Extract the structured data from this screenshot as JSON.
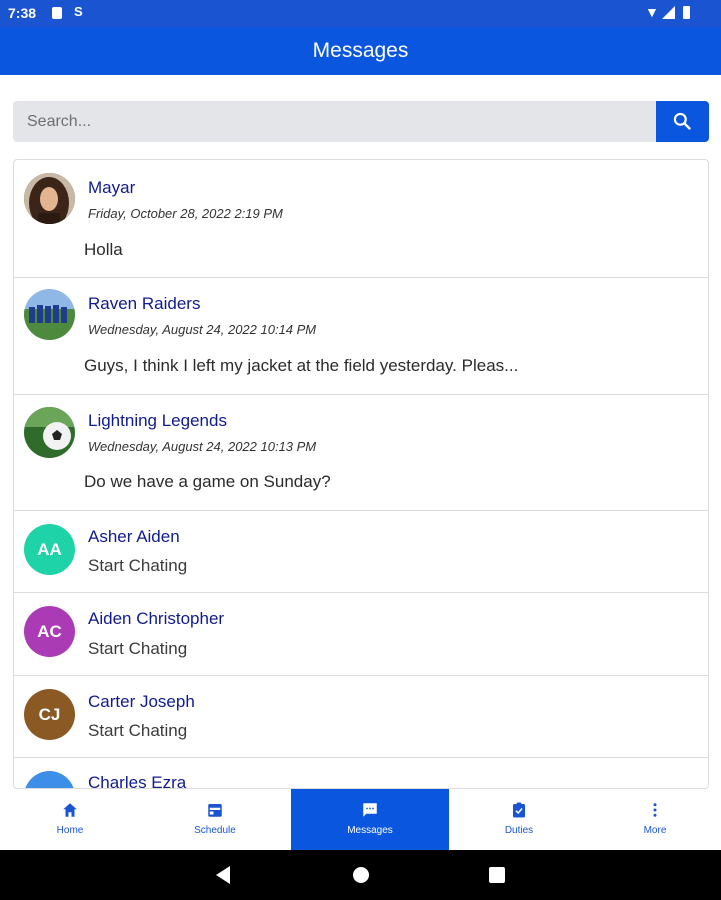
{
  "status_bar": {
    "time": "7:38",
    "sim_label": "S"
  },
  "app_bar": {
    "title": "Messages"
  },
  "search": {
    "placeholder": "Search..."
  },
  "messages": [
    {
      "name": "Mayar",
      "date": "Friday, October 28, 2022 2:19 PM",
      "preview": "Holla",
      "avatar": "photo-woman"
    },
    {
      "name": "Raven Raiders",
      "date": "Wednesday, August 24, 2022 10:14 PM",
      "preview": "Guys, I think I left my jacket at the field yesterday. Pleas...",
      "avatar": "photo-team"
    },
    {
      "name": "Lightning Legends",
      "date": "Wednesday, August 24, 2022 10:13 PM",
      "preview": "Do we have a game on Sunday?",
      "avatar": "photo-soccer-ball"
    }
  ],
  "contacts": [
    {
      "name": "Asher Aiden",
      "initials": "AA",
      "subtitle": "Start Chating",
      "color": "#1ed3a8"
    },
    {
      "name": "Aiden Christopher",
      "initials": "AC",
      "subtitle": "Start Chating",
      "color": "#ab3ab5"
    },
    {
      "name": "Carter Joseph",
      "initials": "CJ",
      "subtitle": "Start Chating",
      "color": "#8b5a24"
    },
    {
      "name": "Charles Ezra",
      "initials": "",
      "subtitle": "",
      "color": "#3d8ee6"
    }
  ],
  "bottom_nav": [
    {
      "label": "Home",
      "icon": "home-icon",
      "active": false
    },
    {
      "label": "Schedule",
      "icon": "calendar-icon",
      "active": false
    },
    {
      "label": "Messages",
      "icon": "chat-icon",
      "active": true
    },
    {
      "label": "Duties",
      "icon": "clipboard-check-icon",
      "active": false
    },
    {
      "label": "More",
      "icon": "more-vertical-icon",
      "active": false
    }
  ],
  "colors": {
    "primary": "#0b56df",
    "status_bar": "#1b54d1",
    "name_text": "#101b8e"
  }
}
